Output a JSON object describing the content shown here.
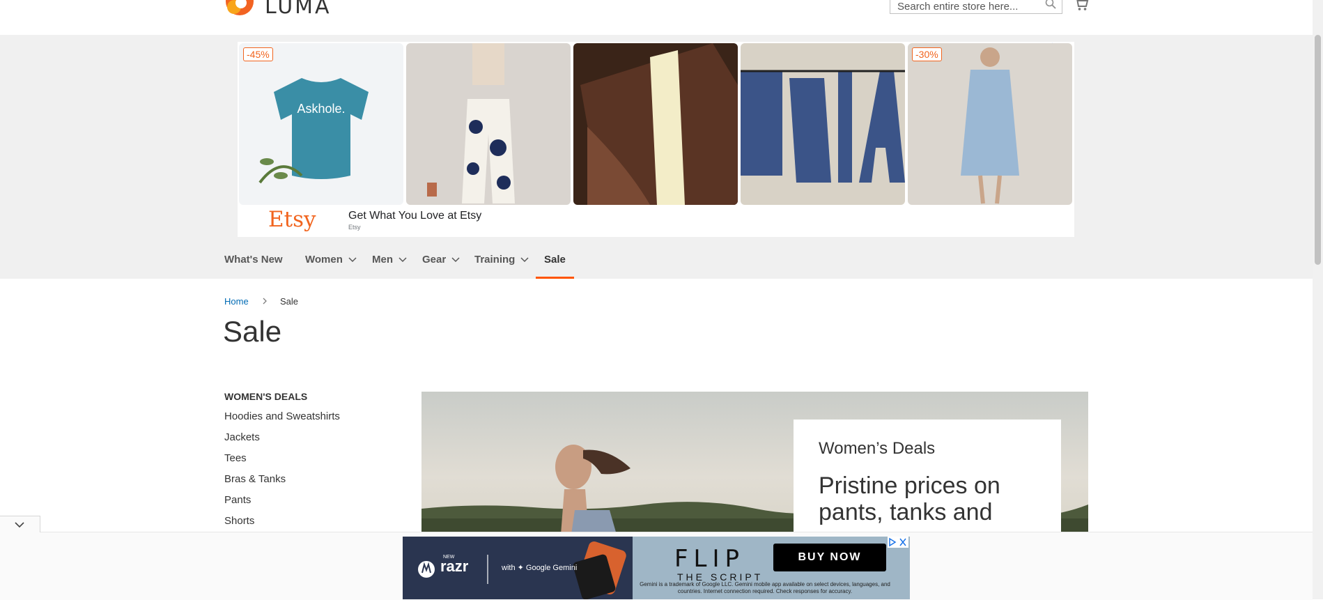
{
  "header": {
    "logo_text": "LUMA",
    "search_placeholder": "Search entire store here...",
    "icons": [
      "luma-logo-icon",
      "search-icon",
      "cart-icon"
    ]
  },
  "top_ad": {
    "badges": [
      "-45%",
      "-30%"
    ],
    "brand": "Etsy",
    "title": "Get What You Love at Etsy",
    "sub": "Etsy",
    "tshirt_text": "Askhole.",
    "brand_color": "#f1641e"
  },
  "nav": {
    "items": [
      {
        "label": "What's New"
      },
      {
        "label": "Women"
      },
      {
        "label": "Men"
      },
      {
        "label": "Gear"
      },
      {
        "label": "Training"
      },
      {
        "label": "Sale"
      }
    ],
    "active": "Sale",
    "accent_color": "#ff5501"
  },
  "breadcrumb": {
    "home": "Home",
    "current": "Sale"
  },
  "page_title": "Sale",
  "sidebar": {
    "title": "WOMEN'S DEALS",
    "items": [
      "Hoodies and Sweatshirts",
      "Jackets",
      "Tees",
      "Bras & Tanks",
      "Pants",
      "Shorts"
    ]
  },
  "hero": {
    "subtitle": "Women’s Deals",
    "title": "Pristine prices on pants, tanks and"
  },
  "bottom_ad": {
    "new_label": "NEW",
    "brand": "razr",
    "partner": "with ✦ Google Gemini",
    "headline": "FLIP",
    "subheadline": "THE SCRIPT",
    "button": "BUY NOW",
    "disclaimer": "Gemini is a trademark of Google LLC. Gemini mobile app available on select devices, languages, and countries. Internet connection required. Check responses for accuracy."
  }
}
